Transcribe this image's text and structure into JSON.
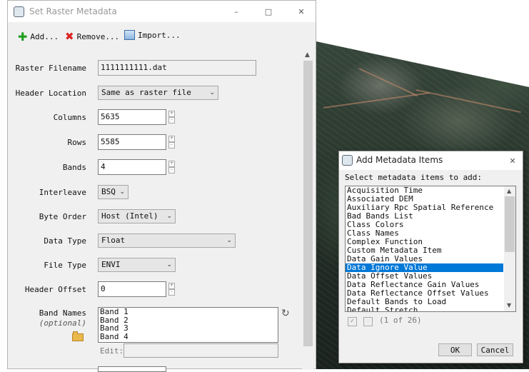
{
  "main_dialog": {
    "title": "Set Raster Metadata",
    "toolbar": {
      "add_label": "Add...",
      "remove_label": "Remove...",
      "import_label": "Import..."
    },
    "fields": {
      "raster_filename_label": "Raster Filename",
      "raster_filename_value": "1111111111.dat",
      "header_location_label": "Header Location",
      "header_location_value": "Same as raster file",
      "columns_label": "Columns",
      "columns_value": "5635",
      "rows_label": "Rows",
      "rows_value": "5585",
      "bands_label": "Bands",
      "bands_value": "4",
      "interleave_label": "Interleave",
      "interleave_value": "BSQ",
      "byte_order_label": "Byte Order",
      "byte_order_value": "Host (Intel)",
      "data_type_label": "Data Type",
      "data_type_value": "Float",
      "file_type_label": "File Type",
      "file_type_value": "ENVI",
      "header_offset_label": "Header Offset",
      "header_offset_value": "0",
      "band_names_label": "Band Names",
      "band_names_optional": "(optional)",
      "band_names": [
        "Band 1",
        "Band 2",
        "Band 3",
        "Band 4"
      ],
      "edit_label": "Edit:"
    }
  },
  "add_dialog": {
    "title": "Add Metadata Items",
    "prompt": "Select metadata items to add:",
    "items": [
      "Acquisition Time",
      "Associated DEM",
      "Auxiliary Rpc Spatial Reference",
      "Bad Bands List",
      "Class Colors",
      "Class Names",
      "Complex Function",
      "Custom Metadata Item",
      "Data Gain Values",
      "Data Ignore Value",
      "Data Offset Values",
      "Data Reflectance Gain Values",
      "Data Reflectance Offset Values",
      "Default Bands to Load",
      "Default Stretch"
    ],
    "selected_item": "Data Ignore Value",
    "count_text": "(1 of 26)",
    "ok_label": "OK",
    "cancel_label": "Cancel",
    "selection_color": "#0078d7"
  }
}
